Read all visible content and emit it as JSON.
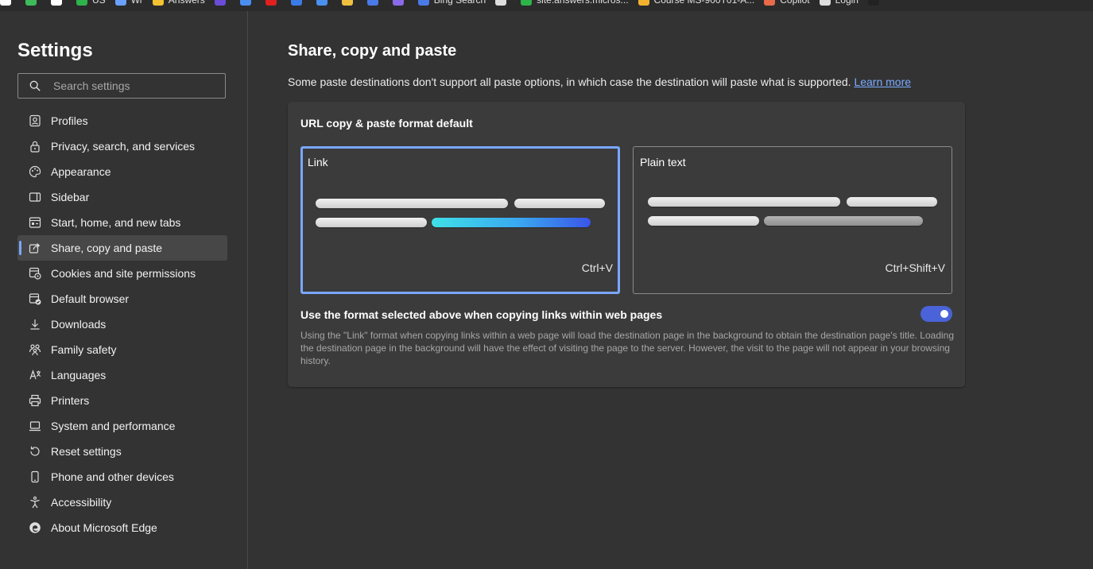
{
  "favorites_bar": {
    "items": [
      {
        "label": "",
        "color": "#ffffff"
      },
      {
        "label": "",
        "color": "#3dbb5a"
      },
      {
        "label": "",
        "color": "#ffffff"
      },
      {
        "label": "US",
        "color": "#2db34a"
      },
      {
        "label": "Wr",
        "color": "#6aa0ff"
      },
      {
        "label": "Answers",
        "color": "#f2c230"
      },
      {
        "label": "",
        "color": "#6a4cd8"
      },
      {
        "label": "",
        "color": "#4a8ef0"
      },
      {
        "label": "",
        "color": "#e02020"
      },
      {
        "label": "",
        "color": "#3a7be8"
      },
      {
        "label": "",
        "color": "#4a90f0"
      },
      {
        "label": "",
        "color": "#f0c040"
      },
      {
        "label": "",
        "color": "#4a7ae8"
      },
      {
        "label": "",
        "color": "#8a6ae8"
      },
      {
        "label": "Bing Search",
        "color": "#4a7ae8"
      },
      {
        "label": "",
        "color": "#dddddd"
      },
      {
        "label": "site:answers.micros...",
        "color": "#2db34a"
      },
      {
        "label": "Course MS-900T01-A...",
        "color": "#f2b230"
      },
      {
        "label": "Copilot",
        "color": "#e86a4a"
      },
      {
        "label": "Login",
        "color": "#dddddd"
      },
      {
        "label": "",
        "color": "#222222"
      }
    ]
  },
  "sidebar": {
    "title": "Settings",
    "search_placeholder": "Search settings",
    "items": [
      {
        "label": "Profiles",
        "icon": "profile-icon",
        "active": false
      },
      {
        "label": "Privacy, search, and services",
        "icon": "lock-icon",
        "active": false
      },
      {
        "label": "Appearance",
        "icon": "palette-icon",
        "active": false
      },
      {
        "label": "Sidebar",
        "icon": "sidebar-icon",
        "active": false
      },
      {
        "label": "Start, home, and new tabs",
        "icon": "home-tabs-icon",
        "active": false
      },
      {
        "label": "Share, copy and paste",
        "icon": "share-icon",
        "active": true
      },
      {
        "label": "Cookies and site permissions",
        "icon": "cookies-icon",
        "active": false
      },
      {
        "label": "Default browser",
        "icon": "default-browser-icon",
        "active": false
      },
      {
        "label": "Downloads",
        "icon": "download-icon",
        "active": false
      },
      {
        "label": "Family safety",
        "icon": "family-icon",
        "active": false
      },
      {
        "label": "Languages",
        "icon": "languages-icon",
        "active": false
      },
      {
        "label": "Printers",
        "icon": "printer-icon",
        "active": false
      },
      {
        "label": "System and performance",
        "icon": "laptop-icon",
        "active": false
      },
      {
        "label": "Reset settings",
        "icon": "reset-icon",
        "active": false
      },
      {
        "label": "Phone and other devices",
        "icon": "phone-icon",
        "active": false
      },
      {
        "label": "Accessibility",
        "icon": "accessibility-icon",
        "active": false
      },
      {
        "label": "About Microsoft Edge",
        "icon": "edge-logo-icon",
        "active": false
      }
    ]
  },
  "main": {
    "title": "Share, copy and paste",
    "intro": "Some paste destinations don't support all paste options, in which case the destination will paste what is supported.",
    "learn_more": "Learn more",
    "card": {
      "title": "URL copy & paste format default",
      "options": [
        {
          "label": "Link",
          "shortcut": "Ctrl+V",
          "selected": true
        },
        {
          "label": "Plain text",
          "shortcut": "Ctrl+Shift+V",
          "selected": false
        }
      ],
      "toggle_label": "Use the format selected above when copying links within web pages",
      "toggle_on": true,
      "description": "Using the \"Link\" format when copying links within a web page will load the destination page in the background to obtain the destination page's title. Loading the destination page in the background will have the effect of visiting the page to the server. However, the visit to the page will not appear in your browsing history."
    }
  },
  "colors": {
    "background": "#333333",
    "card": "#3b3b3b",
    "accent": "#7aa7ff",
    "toggle": "#4a63d8",
    "link": "#7aabff"
  }
}
